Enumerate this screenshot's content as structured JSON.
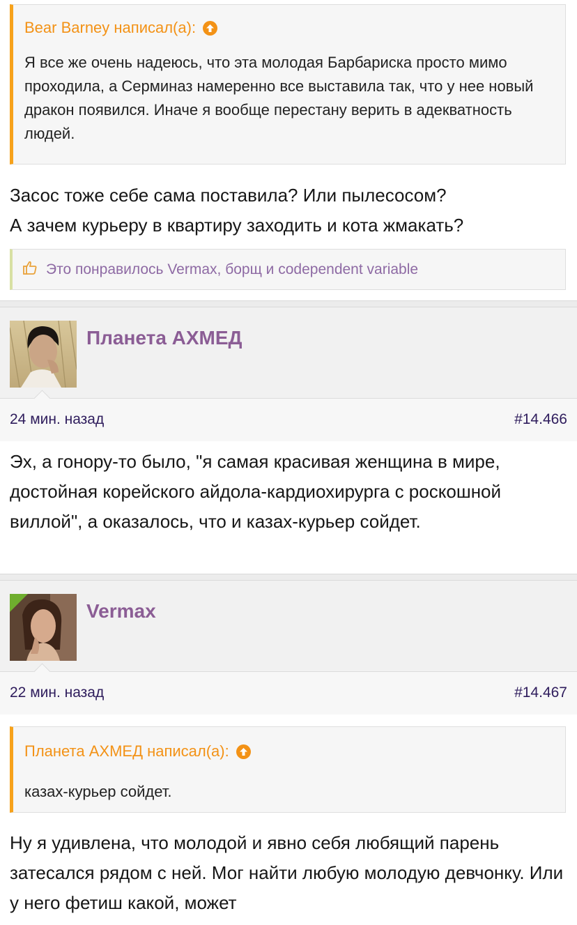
{
  "quote1": {
    "author_label": "Bear Barney написал(а):",
    "text": "Я все же очень надеюсь, что эта молодая Барбариска просто мимо проходила, а Серминаз намеренно все выставила так, что у нее новый дракон появился. Иначе я вообще перестану верить в адекватность людей."
  },
  "post0": {
    "message_line1": "Засос тоже себе сама поставила? Или пылесосом?",
    "message_line2": "А зачем курьеру в квартиру заходить и кота жмакать?",
    "likes_text": "Это понравилось Vermax, борщ и codependent variable"
  },
  "post1": {
    "author": "Планета АХМЕД",
    "time": "24 мин. назад",
    "number": "#14.466",
    "message": "Эх, а гонору-то было, \"я самая красивая женщина в мире, достойная корейского айдола-кардиохирурга с роскошной виллой\", а оказалось, что и казах-курьер сойдет."
  },
  "post2": {
    "author": "Vermax",
    "time": "22 мин. назад",
    "number": "#14.467",
    "quote_author_label": "Планета АХМЕД написал(а):",
    "quote_text": "казах-курьер сойдет.",
    "message": "Ну я удивлена, что молодой и явно себя любящий парень затесался рядом с ней. Мог найти любую молодую девчонку. Или у него фетиш какой, может"
  },
  "colors": {
    "quote_accent": "#f39216",
    "username": "#8b5d95",
    "meta_text": "#2e1c5c",
    "like_text": "#8e6aa4",
    "staff_corner": "#6fae2e"
  }
}
